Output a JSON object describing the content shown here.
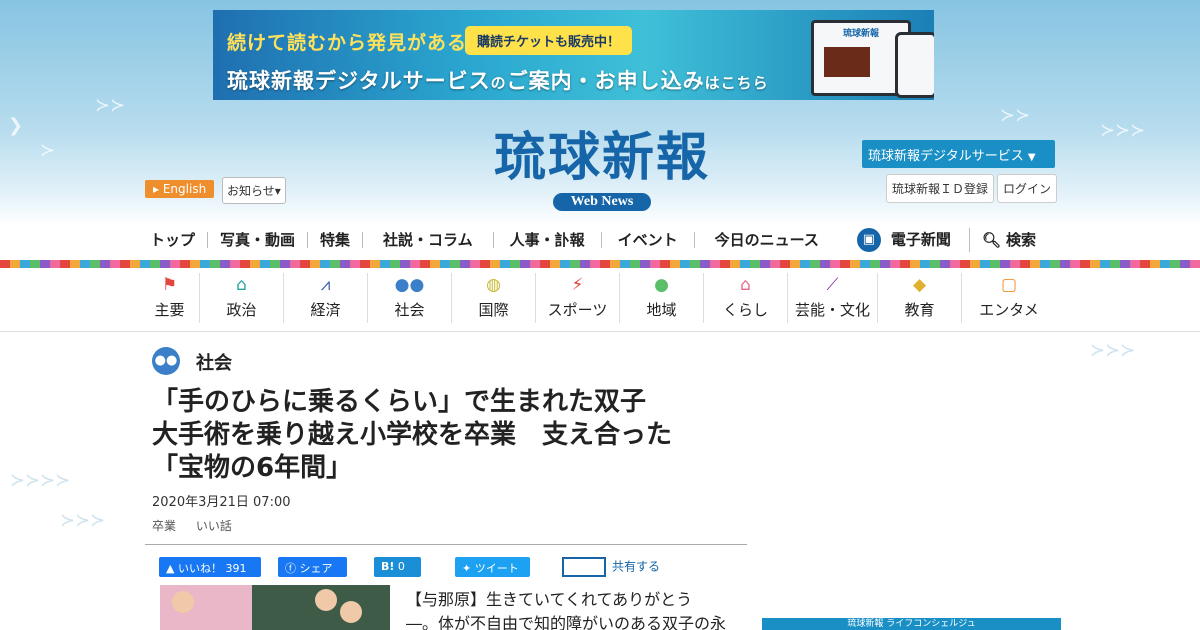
{
  "banner": {
    "line1": "続けて読むから発見がある",
    "badge": "購読チケットも販売中！",
    "line2_main": "琉球新報デジタルサービス",
    "line2_no": "の",
    "line2_rest": "ご案内・お申し込み",
    "line2_end": "はこちら",
    "laptop_logo": "琉球新報"
  },
  "header": {
    "logo_jp": "琉球新報",
    "logo_sub": "Web News",
    "english": "English",
    "oshirase": "お知らせ",
    "digital_service": "琉球新報デジタルサービス",
    "id_register": "琉球新報ＩＤ登録",
    "login": "ログイン"
  },
  "main_nav": [
    "トップ",
    "写真・動画",
    "特集",
    "社説・コラム",
    "人事・訃報",
    "イベント",
    "今日のニュース",
    "電子新聞",
    "検索"
  ],
  "categories": [
    {
      "label": "主要",
      "icon": "flag-icon",
      "color": "#e2463f"
    },
    {
      "label": "政治",
      "icon": "building-icon",
      "color": "#2aa6a0"
    },
    {
      "label": "経済",
      "icon": "chart-icon",
      "color": "#3a5fa8"
    },
    {
      "label": "社会",
      "icon": "people-icon",
      "color": "#3a7fc8"
    },
    {
      "label": "国際",
      "icon": "globe-icon",
      "color": "#c8b830"
    },
    {
      "label": "スポーツ",
      "icon": "runner-icon",
      "color": "#e2463f"
    },
    {
      "label": "地域",
      "icon": "pin-icon",
      "color": "#5bbf6a"
    },
    {
      "label": "くらし",
      "icon": "house-icon",
      "color": "#e86a8a"
    },
    {
      "label": "芸能・文化",
      "icon": "sanshin-icon",
      "color": "#8a3aa8"
    },
    {
      "label": "教育",
      "icon": "graduation-icon",
      "color": "#e2b030"
    },
    {
      "label": "エンタメ",
      "icon": "tv-icon",
      "color": "#ef8e2d"
    }
  ],
  "article": {
    "section": "社会",
    "headline": [
      "「手のひらに乗るくらい」で生まれた双子",
      "大手術を乗り越え小学校を卒業　支え合った",
      "「宝物の6年間」"
    ],
    "timestamp": "2020年3月21日 07:00",
    "tags": [
      "卒業",
      "いい話"
    ],
    "share": {
      "fb_like": "いいね！",
      "fb_count": "391",
      "fb_share": "シェア",
      "hatena": "B!",
      "hatena_count": "0",
      "tweet": "ツイート",
      "mail": "共有する"
    },
    "body": [
      "【与那原】生きていてくれてありがとう",
      "―。体が不自由で知的障がいのある双子の永"
    ]
  },
  "sidebar": {
    "concierge": "琉球新報 ライフコンシェルジュ"
  }
}
